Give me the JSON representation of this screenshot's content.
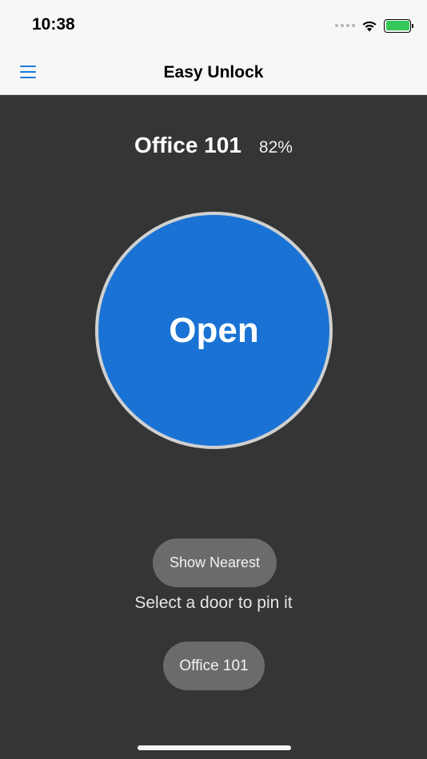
{
  "status_bar": {
    "time": "10:38",
    "battery_color": "#35c759"
  },
  "nav": {
    "title": "Easy Unlock",
    "menu_icon": "hamburger-menu-icon",
    "accent": "#1a7ad9"
  },
  "door": {
    "name": "Office 101",
    "battery_level": "82%"
  },
  "open_button": {
    "label": "Open",
    "color": "#1a73d4"
  },
  "show_nearest_label": "Show Nearest",
  "hint": "Select a door to pin it",
  "doors": [
    {
      "label": "Office 101"
    }
  ]
}
